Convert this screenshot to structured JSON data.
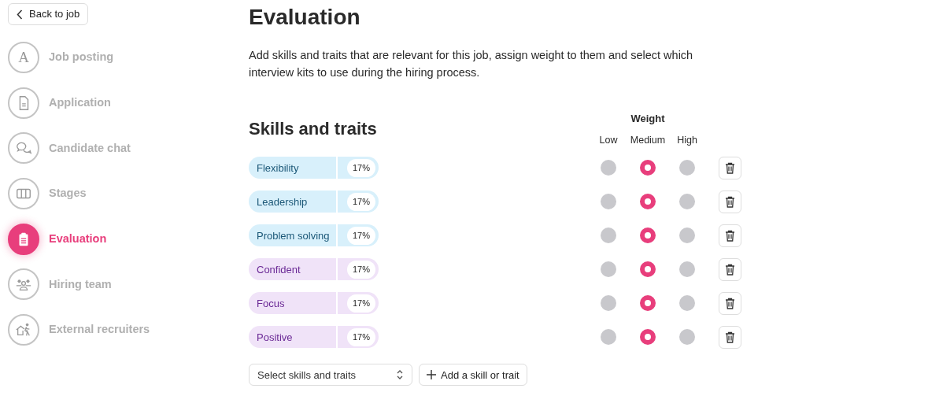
{
  "back_button": {
    "label": "Back to job"
  },
  "steps": [
    {
      "label": "Job posting",
      "icon_text": "A",
      "selected": false
    },
    {
      "label": "Application",
      "selected": false
    },
    {
      "label": "Candidate chat",
      "selected": false
    },
    {
      "label": "Stages",
      "selected": false
    },
    {
      "label": "Evaluation",
      "selected": true
    },
    {
      "label": "Hiring team",
      "selected": false
    },
    {
      "label": "External recruiters",
      "selected": false
    }
  ],
  "title": "Evaluation",
  "description": "Add skills and traits that are relevant for this job, assign weight to them and select which interview kits to use during the hiring process.",
  "skills": {
    "heading": "Skills and traits",
    "weight_heading": "Weight",
    "weight_labels": [
      "Low",
      "Medium",
      "High"
    ],
    "rows": [
      {
        "name": "Flexibility",
        "kind": "skill",
        "share": "17%",
        "weights": [
          {
            "selected": false
          },
          {
            "selected": true
          },
          {
            "selected": false
          }
        ]
      },
      {
        "name": "Leadership",
        "kind": "skill",
        "share": "17%",
        "weights": [
          {
            "selected": false
          },
          {
            "selected": true
          },
          {
            "selected": false
          }
        ]
      },
      {
        "name": "Problem solving",
        "kind": "skill",
        "share": "17%",
        "weights": [
          {
            "selected": false
          },
          {
            "selected": true
          },
          {
            "selected": false
          }
        ]
      },
      {
        "name": "Confident",
        "kind": "trait",
        "share": "17%",
        "weights": [
          {
            "selected": false
          },
          {
            "selected": true
          },
          {
            "selected": false
          }
        ]
      },
      {
        "name": "Focus",
        "kind": "trait",
        "share": "17%",
        "weights": [
          {
            "selected": false
          },
          {
            "selected": true
          },
          {
            "selected": false
          }
        ]
      },
      {
        "name": "Positive",
        "kind": "trait",
        "share": "17%",
        "weights": [
          {
            "selected": false
          },
          {
            "selected": true
          },
          {
            "selected": false
          }
        ]
      }
    ]
  },
  "select": {
    "placeholder": "Select skills and traits"
  },
  "add_button": {
    "label": "Add a skill or trait"
  }
}
